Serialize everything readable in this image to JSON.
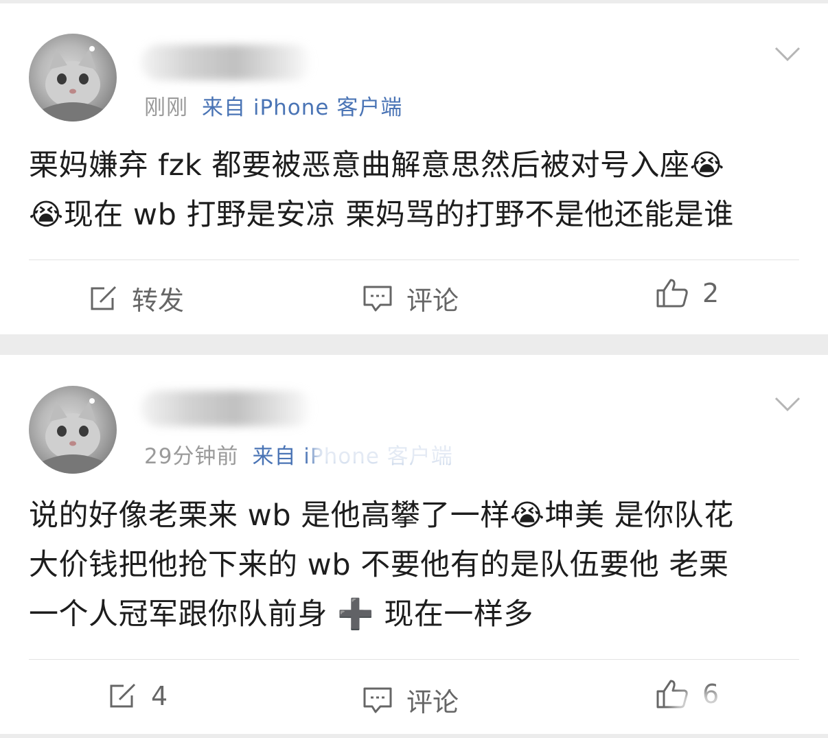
{
  "posts": [
    {
      "time": "刚刚",
      "source": "来自 iPhone 客户端",
      "content_lines": [
        "栗妈嫌弃 fzk 都要被恶意曲解意思然后被对号入座😭",
        "😭现在 wb 打野是安凉 栗妈骂的打野不是他还能是谁"
      ],
      "actions": {
        "repost_label": "转发",
        "comment_label": "评论",
        "like_count": "2"
      }
    },
    {
      "time": "29分钟前",
      "source": "来自 iPhone 客户端",
      "content_lines": [
        "说的好像老栗来 wb 是他高攀了一样😭坤美 是你队花",
        "大价钱把他抢下来的 wb 不要他有的是队伍要他 老栗",
        "一个人冠军跟你队前身 ➕ 现在一样多"
      ],
      "actions": {
        "repost_label": "4",
        "comment_label": "评论",
        "like_count": "6"
      }
    }
  ],
  "icons": {
    "avatar": "cat-avatar-icon",
    "menu": "chevron-down-icon",
    "repost": "share-edit-icon",
    "comment": "comment-icon",
    "like": "thumbs-up-icon"
  },
  "colors": {
    "source_link": "#4a74b5",
    "meta_gray": "#9a9a9a",
    "background": "#ececec"
  }
}
